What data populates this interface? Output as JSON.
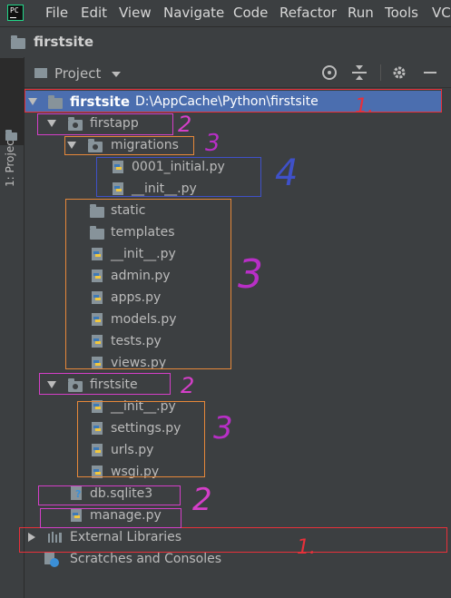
{
  "menu": {
    "items": [
      "File",
      "Edit",
      "View",
      "Navigate",
      "Code",
      "Refactor",
      "Run",
      "Tools",
      "VC"
    ]
  },
  "navbar": {
    "title": "firstsite"
  },
  "sidebar": {
    "tab_label": "1: Project"
  },
  "panel": {
    "title": "Project"
  },
  "tree": {
    "root_name": "firstsite",
    "root_path": "D:\\AppCache\\Python\\firstsite",
    "firstapp": "firstapp",
    "migrations": "migrations",
    "migration_files": [
      "0001_initial.py",
      "__init__.py"
    ],
    "static": "static",
    "templates": "templates",
    "firstapp_files": [
      "__init__.py",
      "admin.py",
      "apps.py",
      "models.py",
      "tests.py",
      "views.py"
    ],
    "firstsite_pkg": "firstsite",
    "firstsite_files": [
      "__init__.py",
      "settings.py",
      "urls.py",
      "wsgi.py"
    ],
    "db": "db.sqlite3",
    "manage": "manage.py",
    "external": "External Libraries",
    "scratches": "Scratches and Consoles"
  },
  "colors": {
    "background": "#3c3f41",
    "selection": "#4b6eaf",
    "annotation_red": "#e8303a",
    "annotation_magenta": "#d43fc8",
    "annotation_orange": "#e6883a",
    "annotation_blue": "#3f51c8"
  },
  "annotations": {
    "red_1": "1.",
    "red_2": "1.",
    "mag_firstapp": "2",
    "mag_firstsite": "2",
    "mag_db": "2",
    "orange_migrations": "3",
    "purple_firstapp_files": "3",
    "purple_firstsite_files": "3",
    "blue_migration_files": "4"
  }
}
